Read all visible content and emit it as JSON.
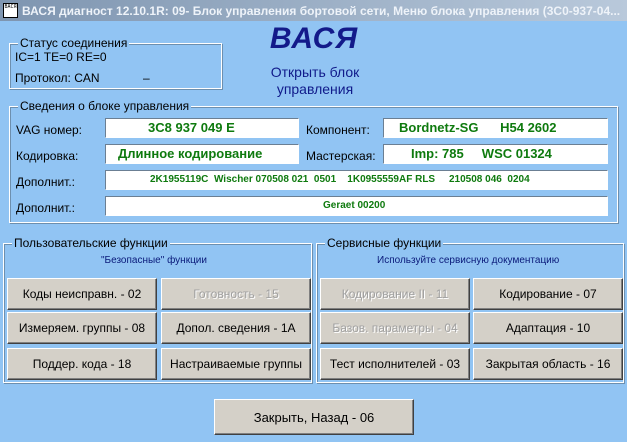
{
  "window": {
    "title": "ВАСЯ диагност 12.10.1R: 09- Блок управления бортовой сети, Меню блока управления (3C0-937-04...",
    "icon_text": "ВАСЯ"
  },
  "connection": {
    "title": "Статус соединения",
    "status": "IC=1  TE=0  RE=0",
    "protocol": "Протокол: CAN",
    "indicator": "–"
  },
  "brand": {
    "name": "ВАСЯ",
    "open_block": "Открыть блок управления"
  },
  "ecu_info": {
    "title": "Сведения о блоке управления",
    "vag_label": "VAG номер:",
    "vag_value": "3C8 937 049 E",
    "component_label": "Компонент:",
    "component_value": "Bordnetz-SG      H54 2602",
    "coding_label": "Кодировка:",
    "coding_value": "Длинное кодирование",
    "workshop_label": "Мастерская:",
    "workshop_value": "Imp: 785     WSC 01324",
    "extra1_label": "Дополнит.:",
    "extra1_value": "2K1955119C  Wischer 070508 021  0501    1K0955559AF RLS     210508 046  0204",
    "extra2_label": "Дополнит.:",
    "extra2_value": "Geraet 00200"
  },
  "user_functions": {
    "title": "Пользовательские функции",
    "subtitle": "\"Безопасные\" функции",
    "fault_codes": "Коды неисправн. - 02",
    "readiness": "Готовность - 15",
    "measuring": "Измеряем. группы - 08",
    "add_info": "Допол. сведения - 1А",
    "supported_codes": "Поддер. кода - 18",
    "custom_groups": "Настраиваемые группы"
  },
  "service_functions": {
    "title": "Сервисные функции",
    "subtitle": "Используйте сервисную документацию",
    "coding2": "Кодирование II - 11",
    "coding": "Кодирование - 07",
    "basic_settings": "Базов. параметры - 04",
    "adaptation": "Адаптация - 10",
    "output_test": "Тест исполнителей - 03",
    "security_access": "Закрытая область - 16"
  },
  "footer": {
    "close_back": "Закрыть, Назад - 06"
  }
}
